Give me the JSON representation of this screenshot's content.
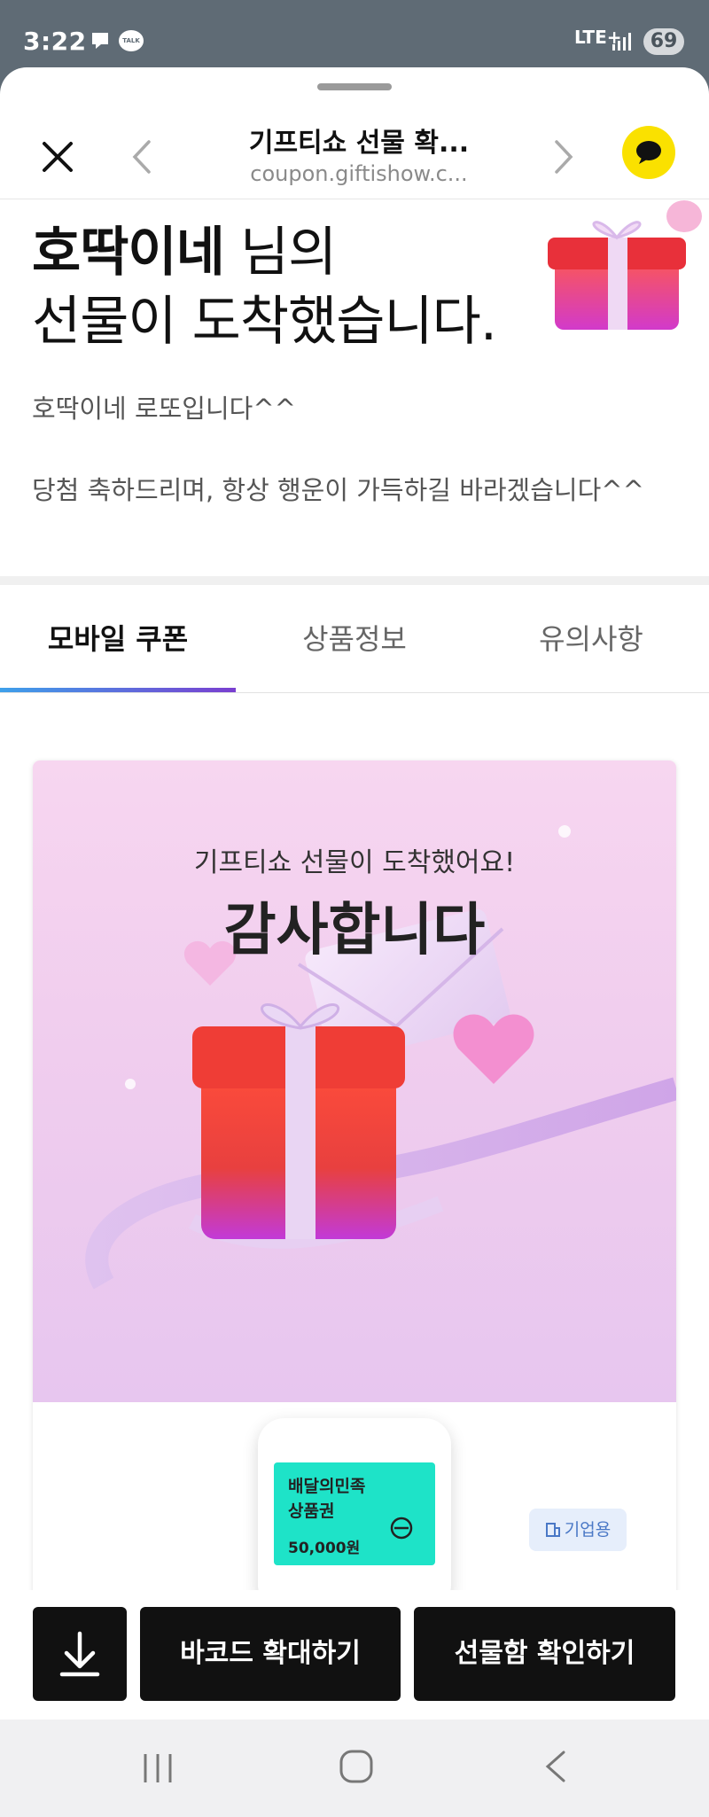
{
  "status": {
    "time": "3:22",
    "network": "LTE+",
    "battery": "69",
    "talk_label": "TALK"
  },
  "header": {
    "title": "기프티쇼 선물 확...",
    "url": "coupon.giftishow.c..."
  },
  "greeting": {
    "name": "호딱이네",
    "suffix": " 님의",
    "line2": "선물이 도착했습니다."
  },
  "message": {
    "line1": "호딱이네 로또입니다^^",
    "line2": "당첨 축하드리며, 항상 행운이 가득하길 바라겠습니다^^"
  },
  "tabs": [
    {
      "label": "모바일 쿠폰",
      "active": true
    },
    {
      "label": "상품정보",
      "active": false
    },
    {
      "label": "유의사항",
      "active": false
    }
  ],
  "card": {
    "subtitle": "기프티쇼 선물이 도착했어요!",
    "headline": "감사합니다",
    "voucher": {
      "line1": "배달의민족",
      "line2": "상품권",
      "amount": "50,000원",
      "color": "#1ee3c8"
    },
    "badge": "기업용"
  },
  "buttons": {
    "barcode": "바코드 확대하기",
    "giftbox": "선물함 확인하기"
  },
  "icons": [
    "close-icon",
    "back-arrow-icon",
    "forward-arrow-icon",
    "kakaotalk-icon",
    "download-icon",
    "gift-box-icon",
    "heart-icon",
    "envelope-icon",
    "building-icon"
  ],
  "colors": {
    "kakao_yellow": "#fae100",
    "tab_gradient_start": "#3ea0ea",
    "tab_gradient_end": "#7a3fd0",
    "button_bg": "#111111"
  }
}
